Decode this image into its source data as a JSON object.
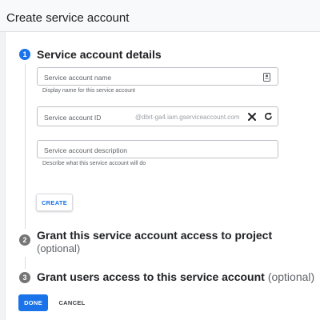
{
  "page": {
    "title": "Create service account"
  },
  "steps": [
    {
      "number": "1",
      "title": "Service account details"
    },
    {
      "number": "2",
      "title": "Grant this service account access to project",
      "optional": "(optional)"
    },
    {
      "number": "3",
      "title": "Grant users access to this service account",
      "optional": "(optional)"
    }
  ],
  "form": {
    "name": {
      "placeholder": "Service account name",
      "hint": "Display name for this service account"
    },
    "id": {
      "label": "Service account ID",
      "suffix": "@dbrt-ga4.iam.gserviceaccount.com"
    },
    "description": {
      "placeholder": "Service account description",
      "hint": "Describe what this service account will do"
    }
  },
  "buttons": {
    "create": "CREATE",
    "done": "DONE",
    "cancel": "CANCEL"
  },
  "icons": {
    "name_field": "contact-card-icon",
    "clear": "close-icon",
    "refresh": "refresh-icon"
  },
  "colors": {
    "primary": "#1a73e8",
    "step_inactive": "#757575"
  }
}
